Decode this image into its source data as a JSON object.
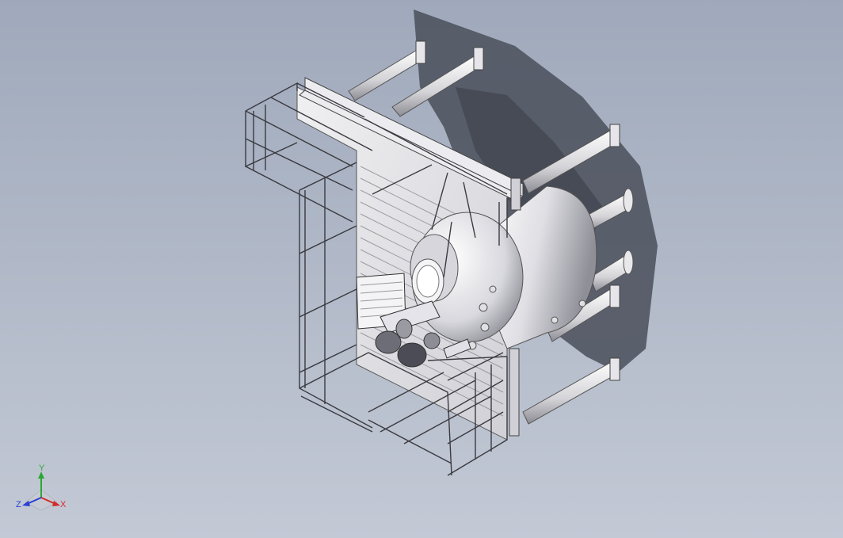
{
  "viewport": {
    "background_top": "#9fa9bb",
    "background_bottom": "#c3c9d5"
  },
  "triad": {
    "x_label": "X",
    "y_label": "Y",
    "z_label": "Z",
    "x_color": "#d42a2a",
    "y_color": "#2aa832",
    "z_color": "#2a3fd4"
  }
}
